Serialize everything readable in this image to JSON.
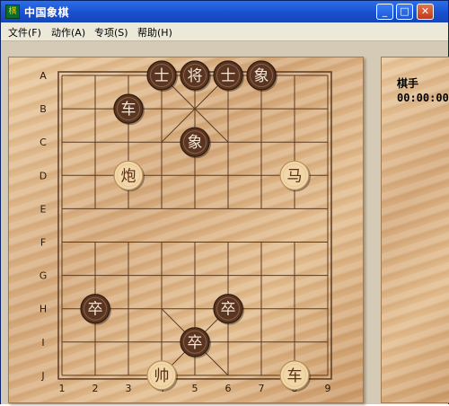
{
  "window": {
    "title": "中国象棋",
    "icon": "chess-app-icon"
  },
  "title_buttons": {
    "minimize": "_",
    "maximize": "□",
    "close": "✕"
  },
  "menu": [
    {
      "label": "文件(F)"
    },
    {
      "label": "动作(A)"
    },
    {
      "label": "专项(S)"
    },
    {
      "label": "帮助(H)"
    }
  ],
  "board": {
    "row_labels": [
      "A",
      "B",
      "C",
      "D",
      "E",
      "F",
      "G",
      "H",
      "I",
      "J"
    ],
    "col_labels": [
      "1",
      "2",
      "3",
      "4",
      "5",
      "6",
      "7",
      "8",
      "9"
    ],
    "pieces": [
      {
        "char": "士",
        "side": "black",
        "col": 4,
        "row": 0
      },
      {
        "char": "将",
        "side": "black",
        "col": 5,
        "row": 0
      },
      {
        "char": "士",
        "side": "black",
        "col": 6,
        "row": 0
      },
      {
        "char": "象",
        "side": "black",
        "col": 7,
        "row": 0
      },
      {
        "char": "车",
        "side": "black",
        "col": 3,
        "row": 1
      },
      {
        "char": "象",
        "side": "black",
        "col": 5,
        "row": 2
      },
      {
        "char": "炮",
        "side": "red",
        "col": 3,
        "row": 3
      },
      {
        "char": "马",
        "side": "red",
        "col": 8,
        "row": 3
      },
      {
        "char": "卒",
        "side": "black",
        "col": 2,
        "row": 7
      },
      {
        "char": "卒",
        "side": "black",
        "col": 6,
        "row": 7
      },
      {
        "char": "卒",
        "side": "black",
        "col": 5,
        "row": 8
      },
      {
        "char": "帅",
        "side": "red",
        "col": 4,
        "row": 9
      },
      {
        "char": "车",
        "side": "red",
        "col": 8,
        "row": 9
      }
    ]
  },
  "panel": {
    "player_label": "棋手",
    "timer": "00:00:00"
  },
  "colors": {
    "black_piece": "#5a3522",
    "red_piece": "#f0d6a8",
    "grid": "#5a3a22"
  }
}
